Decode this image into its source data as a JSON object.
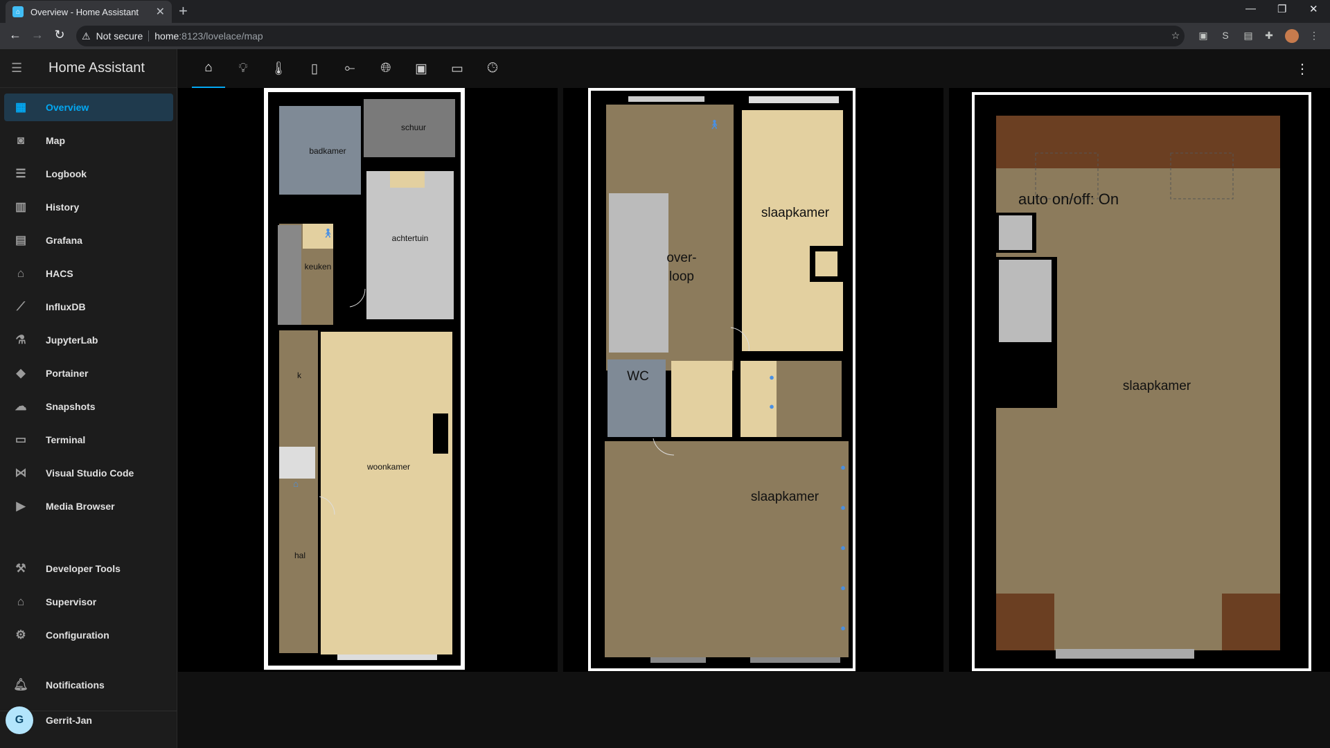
{
  "browser": {
    "tab_title": "Overview - Home Assistant",
    "new_tab": "+",
    "security": "Not secure",
    "url_host": "home",
    "url_path": ":8123/lovelace/map",
    "window": {
      "minimize": "—",
      "restore": "❐",
      "close": "✕"
    }
  },
  "app": {
    "title": "Home Assistant"
  },
  "sidebar": {
    "items": [
      {
        "label": "Overview",
        "icon": "view-dashboard-icon",
        "active": true
      },
      {
        "label": "Map",
        "icon": "map-icon"
      },
      {
        "label": "Logbook",
        "icon": "logbook-icon"
      },
      {
        "label": "History",
        "icon": "history-chart-icon"
      },
      {
        "label": "Grafana",
        "icon": "grafana-icon"
      },
      {
        "label": "HACS",
        "icon": "hacs-icon"
      },
      {
        "label": "InfluxDB",
        "icon": "influxdb-icon"
      },
      {
        "label": "JupyterLab",
        "icon": "flask-icon"
      },
      {
        "label": "Portainer",
        "icon": "whale-icon"
      },
      {
        "label": "Snapshots",
        "icon": "cloud-icon"
      },
      {
        "label": "Terminal",
        "icon": "terminal-icon"
      },
      {
        "label": "Visual Studio Code",
        "icon": "vscode-icon"
      },
      {
        "label": "Media Browser",
        "icon": "play-box-icon"
      }
    ],
    "bottom_items": [
      {
        "label": "Developer Tools",
        "icon": "hammer-icon"
      },
      {
        "label": "Supervisor",
        "icon": "home-assistant-icon"
      },
      {
        "label": "Configuration",
        "icon": "cog-icon"
      }
    ],
    "notifications": "Notifications",
    "user": {
      "name": "Gerrit-Jan",
      "initial": "G"
    }
  },
  "view_tabs": [
    "home-icon",
    "lightbulb-icon",
    "thermometer-icon",
    "battery-icon",
    "switch-icon",
    "web-icon",
    "tablet-icon",
    "monitor-icon",
    "clock-icon"
  ],
  "floors": {
    "ground": {
      "rooms": {
        "badkamer": "badkamer",
        "schuur": "schuur",
        "achtertuin": "achtertuin",
        "keuken": "keuken",
        "k": "k",
        "woonkamer": "woonkamer",
        "hal": "hal"
      }
    },
    "first": {
      "rooms": {
        "overloop": "over- loop",
        "slaapkamer_1": "slaapkamer",
        "wc": "WC",
        "slaapkamer_2": "slaapkamer"
      }
    },
    "attic": {
      "status": "auto on/off: On",
      "rooms": {
        "slaapkamer": "slaapkamer"
      }
    }
  },
  "colors": {
    "accent": "#03a9f4",
    "room_beige": "#e3d0a0",
    "room_brown": "#8c7b5c",
    "room_grey": "#7f8a96",
    "sidebar_bg": "#1c1c1c"
  }
}
